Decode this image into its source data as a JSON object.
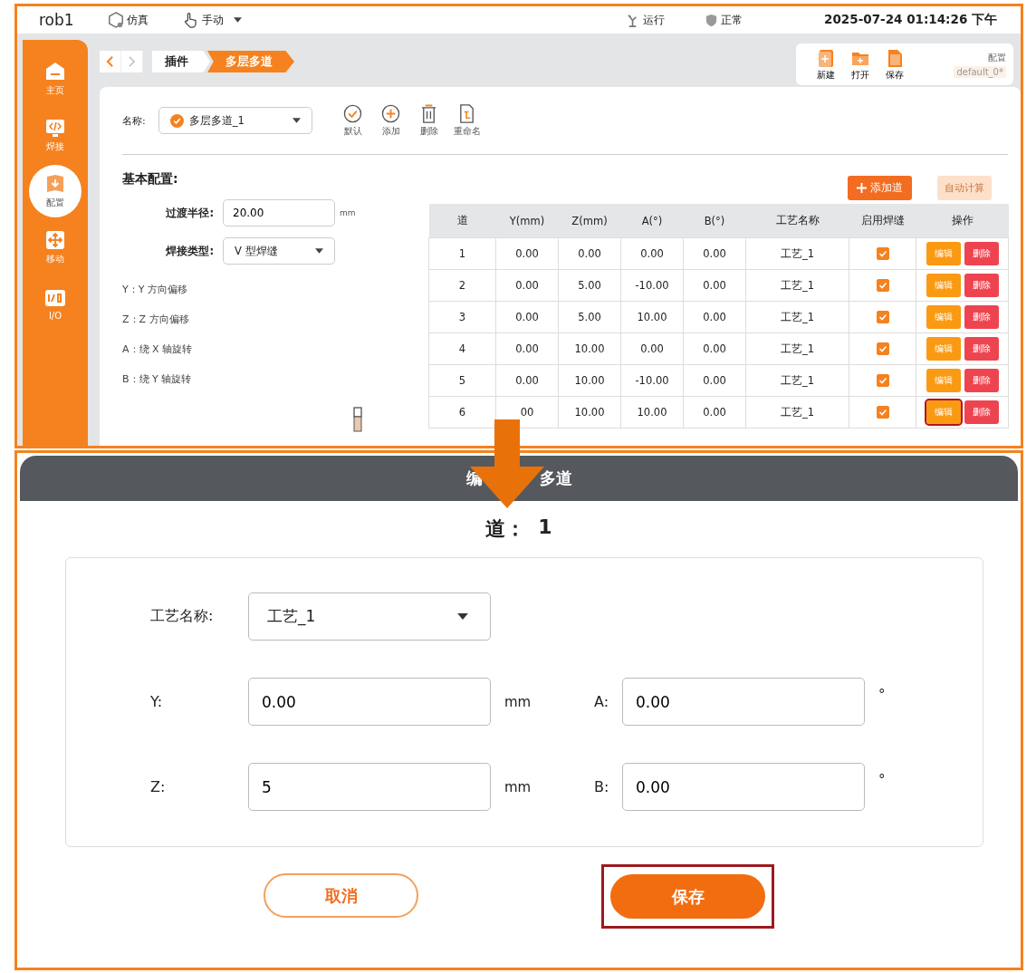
{
  "top_bar": {
    "robot": "rob1",
    "mode": "仿真",
    "control": "手动",
    "run_status": "运行",
    "safety": "正常",
    "datetime": "2025-07-24 01:14:26 下午"
  },
  "sidebar": {
    "items": [
      {
        "label": "主页",
        "kind": "home",
        "selected": false
      },
      {
        "label": "焊接",
        "kind": "code",
        "selected": false
      },
      {
        "label": "配置",
        "kind": "config",
        "selected": true
      },
      {
        "label": "移动",
        "kind": "move",
        "selected": false
      },
      {
        "label": "I/O",
        "kind": "io",
        "selected": false
      }
    ]
  },
  "breadcrumb": [
    {
      "label": "插件",
      "selected": false
    },
    {
      "label": "多层多道",
      "selected": true
    }
  ],
  "file_toolbar": {
    "buttons": [
      {
        "label": "新建",
        "kind": "new"
      },
      {
        "label": "打开",
        "kind": "open"
      },
      {
        "label": "保存",
        "kind": "save"
      }
    ],
    "config_label": "配置",
    "config_name": "default_0*"
  },
  "name_row": {
    "label": "名称:",
    "value": "多层多道_1",
    "actions": [
      {
        "label": "默认",
        "kind": "check"
      },
      {
        "label": "添加",
        "kind": "add"
      },
      {
        "label": "删除",
        "kind": "delete"
      },
      {
        "label": "重命名",
        "kind": "rename"
      }
    ]
  },
  "basic_config": {
    "title": "基本配置:",
    "add_button": "添加道",
    "auto_button": {
      "label": "自动计算",
      "disabled": true
    },
    "transition": {
      "label": "过渡半径:",
      "value": "20.00",
      "unit": "mm"
    },
    "weld_type": {
      "label": "焊接类型:",
      "value": "V 型焊缝"
    },
    "legend": [
      "Y：Y 方向偏移",
      "Z：Z 方向偏移",
      "A：绕 X 轴旋转",
      "B：绕 Y 轴旋转"
    ]
  },
  "table": {
    "columns": [
      "道",
      "Y(mm)",
      "Z(mm)",
      "A(°)",
      "B(°)",
      "工艺名称",
      "启用焊缝",
      "操作"
    ],
    "rows": [
      {
        "cells": [
          "1",
          "0.00",
          "0.00",
          "0.00",
          "0.00",
          "工艺_1"
        ],
        "enabled": true,
        "edit": "编辑",
        "delete": "删除",
        "highlighted": false
      },
      {
        "cells": [
          "2",
          "0.00",
          "5.00",
          "-10.00",
          "0.00",
          "工艺_1"
        ],
        "enabled": true,
        "edit": "编辑",
        "delete": "删除",
        "highlighted": false
      },
      {
        "cells": [
          "3",
          "0.00",
          "5.00",
          "10.00",
          "0.00",
          "工艺_1"
        ],
        "enabled": true,
        "edit": "编辑",
        "delete": "删除",
        "highlighted": false
      },
      {
        "cells": [
          "4",
          "0.00",
          "10.00",
          "0.00",
          "0.00",
          "工艺_1"
        ],
        "enabled": true,
        "edit": "编辑",
        "delete": "删除",
        "highlighted": false
      },
      {
        "cells": [
          "5",
          "0.00",
          "10.00",
          "-10.00",
          "0.00",
          "工艺_1"
        ],
        "enabled": true,
        "edit": "编辑",
        "delete": "删除",
        "highlighted": false
      },
      {
        "cells": [
          "6",
          "00",
          "10.00",
          "10.00",
          "0.00",
          "工艺_1"
        ],
        "enabled": true,
        "edit": "编辑",
        "delete": "删除",
        "highlighted": true
      }
    ]
  },
  "dialog": {
    "title_parts": [
      "编",
      "多道"
    ],
    "pass_label": "道：",
    "pass_number": "1",
    "process": {
      "label": "工艺名称:",
      "value": "工艺_1"
    },
    "fields": [
      {
        "label": "Y:",
        "value": "0.00",
        "unit": "mm"
      },
      {
        "label": "A:",
        "value": "0.00",
        "unit": "°"
      },
      {
        "label": "Z:",
        "value": "5",
        "unit": "mm"
      },
      {
        "label": "B:",
        "value": "0.00",
        "unit": "°"
      }
    ],
    "cancel": "取消",
    "save": {
      "label": "保存",
      "highlighted": true
    }
  }
}
